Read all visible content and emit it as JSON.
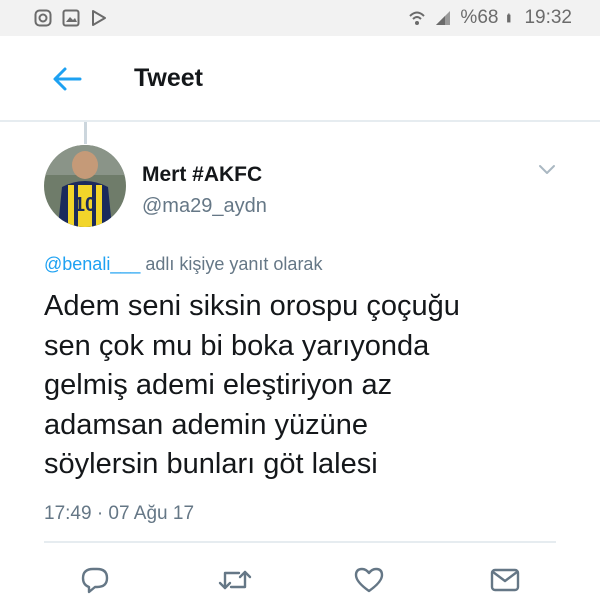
{
  "status_bar": {
    "battery": "%68",
    "time": "19:32",
    "left_icons": [
      "instagram-icon",
      "gallery-icon",
      "play-store-icon"
    ],
    "right_icons": [
      "wifi-icon",
      "signal-icon",
      "battery-icon"
    ]
  },
  "header": {
    "title": "Tweet",
    "back_icon": "back-arrow-icon",
    "accent_color": "#1da1f2"
  },
  "tweet": {
    "author": {
      "name": "Mert #AKFC",
      "handle": "@ma29_aydn",
      "avatar": "avatar-player-jersey-10"
    },
    "reply_to": {
      "mention": "@benali___",
      "suffix": " adlı kişiye yanıt olarak"
    },
    "text": "Adem seni siksin orospu çoçuğu\nsen çok mu bi boka yarıyonda\ngelmiş ademi eleştiriyon az\nadamsan ademin yüzüne\nsöylersin bunları göt lalesi",
    "timestamp": "17:49 · 07 Ağu 17"
  },
  "actions": [
    "reply-icon",
    "retweet-icon",
    "like-icon",
    "message-icon"
  ]
}
